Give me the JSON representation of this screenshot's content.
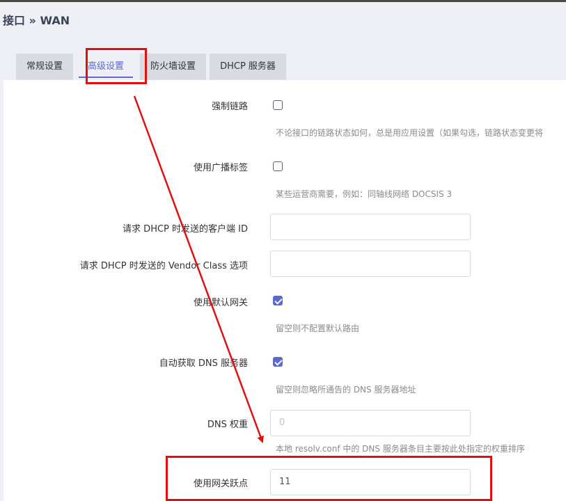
{
  "header": {
    "title": "接口 » WAN"
  },
  "tabs": [
    {
      "label": "常规设置"
    },
    {
      "label": "高级设置"
    },
    {
      "label": "防火墙设置"
    },
    {
      "label": "DHCP 服务器"
    }
  ],
  "form": {
    "force_link": {
      "label": "强制链路",
      "checked": false,
      "desc": "不论接口的链路状态如何，总是用应用设置（如果勾选，链路状态变更将"
    },
    "broadcast_flag": {
      "label": "使用广播标签",
      "checked": false,
      "desc": "某些运营商需要，例如：同轴线网络 DOCSIS 3"
    },
    "client_id": {
      "label": "请求 DHCP 时发送的客户端 ID",
      "value": ""
    },
    "vendor_class": {
      "label": "请求 DHCP 时发送的 Vendor Class 选项",
      "value": ""
    },
    "default_gateway": {
      "label": "使用默认网关",
      "checked": true,
      "desc": "留空则不配置默认路由"
    },
    "peer_dns": {
      "label": "自动获取 DNS 服务器",
      "checked": true,
      "desc": "留空则忽略所通告的 DNS 服务器地址"
    },
    "dns_weight": {
      "label": "DNS 权重",
      "placeholder": "0",
      "desc": "本地 resolv.conf 中的 DNS 服务器条目主要按此处指定的权重排序"
    },
    "gateway_metric": {
      "label": "使用网关跃点",
      "value": "11"
    }
  },
  "annotation": {
    "color": "#e01010"
  }
}
